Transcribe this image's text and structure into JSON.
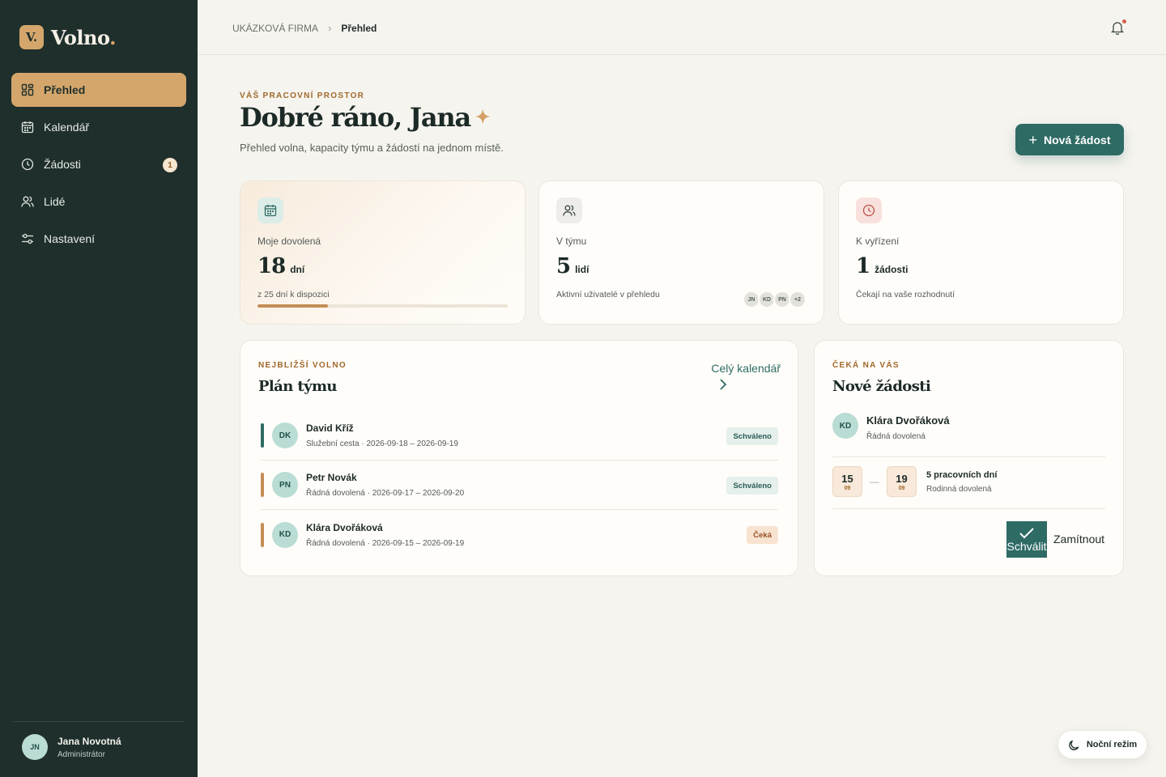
{
  "brand": {
    "mark": "V.",
    "name": "Volno",
    "dot": "."
  },
  "nav": {
    "items": [
      {
        "label": "Přehled",
        "icon": "dashboard-icon",
        "active": true
      },
      {
        "label": "Kalendář",
        "icon": "calendar-icon"
      },
      {
        "label": "Žádosti",
        "icon": "clock-icon",
        "badge": "1"
      },
      {
        "label": "Lidé",
        "icon": "people-icon"
      },
      {
        "label": "Nastavení",
        "icon": "sliders-icon"
      }
    ]
  },
  "user": {
    "initials": "JN",
    "name": "Jana Novotná",
    "role": "Administrátor"
  },
  "breadcrumb": {
    "company": "UKÁZKOVÁ FIRMA",
    "separator": "›",
    "current": "Přehled"
  },
  "hero": {
    "eyebrow": "VÁŠ PRACOVNÍ PROSTOR",
    "title": "Dobré ráno, Jana",
    "spark": "✦",
    "subtitle": "Přehled volna, kapacity týmu a žádostí na jednom místě.",
    "new_button": "Nová žádost",
    "new_button_icon": "+"
  },
  "stats": {
    "vacation": {
      "label": "Moje dovolená",
      "value": "18",
      "unit": "dní",
      "note": "z 25 dní k dispozici",
      "progress": 0.28
    },
    "team": {
      "label": "V týmu",
      "value": "5",
      "unit": "lidí",
      "note": "Aktivní uživatelé v přehledu",
      "avatars": [
        "JN",
        "KD",
        "PN",
        "+2"
      ]
    },
    "pending": {
      "label": "K vyřízení",
      "value": "1",
      "unit": "žádosti",
      "note": "Čekají na vaše rozhodnutí"
    }
  },
  "plan": {
    "eyebrow": "NEJBLIŽŠÍ VOLNO",
    "title": "Plán týmu",
    "link": "Celý kalendář",
    "link_chevron": "›",
    "rows": [
      {
        "initials": "DK",
        "name": "David Kříž",
        "meta": "Služební cesta · 2026-09-18 – 2026-09-19",
        "status": "Schváleno",
        "bar": "#2e6b64"
      },
      {
        "initials": "PN",
        "name": "Petr Novák",
        "meta": "Řádná dovolená · 2026-09-17 – 2026-09-20",
        "status": "Schváleno",
        "bar": "#c48d55"
      },
      {
        "initials": "KD",
        "name": "Klára Dvořáková",
        "meta": "Řádná dovolená · 2026-09-15 – 2026-09-19",
        "status": "Čeká",
        "bar": "#c48d55"
      }
    ]
  },
  "requests": {
    "eyebrow": "ČEKÁ NA VÁS",
    "title": "Nové žádosti",
    "initials": "KD",
    "name": "Klára Dvořáková",
    "type": "Řádná dovolená",
    "from_day": "15",
    "from_month": "09",
    "dash": "—",
    "to_day": "19",
    "to_month": "09",
    "days": "5 pracovních dní",
    "reason": "Rodinná dovolená",
    "approve": "Schválit",
    "reject": "Zamítnout"
  },
  "night_mode": "Noční režim",
  "colors": {
    "sidebar": "#1f2f2c",
    "accent": "#d4a66b",
    "primary": "#2e6b64",
    "background": "#f6f4ef"
  }
}
